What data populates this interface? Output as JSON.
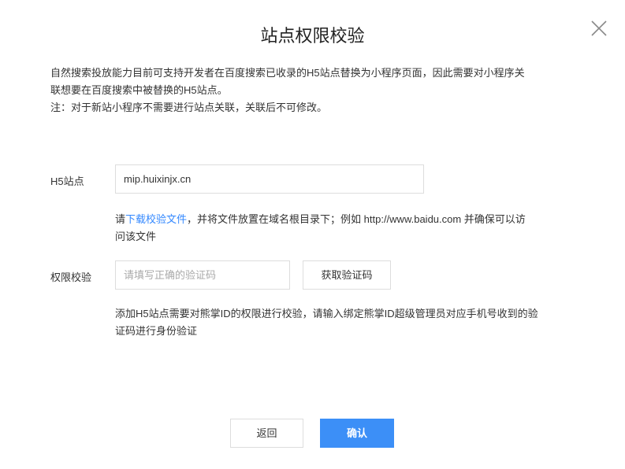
{
  "dialog": {
    "title": "站点权限校验",
    "close_icon": "close-icon"
  },
  "intro": {
    "lines": [
      "自然搜索投放能力目前可支持开发者在百度搜索已收录的H5站点替换为小程序页面，因此需要对小程序关",
      "联想要在百度搜索中被替换的H5站点。",
      "注：对于新站小程序不需要进行站点关联，关联后不可修改。"
    ]
  },
  "site": {
    "label": "H5站点",
    "value": "mip.huixinjx.cn",
    "help_prefix": "请",
    "help_link": "下载校验文件",
    "help_rest": "，并将文件放置在域名根目录下；例如 http://www.baidu.com 并确保可以访",
    "help_line2": "问该文件"
  },
  "verify": {
    "label": "权限校验",
    "placeholder": "请填写正确的验证码",
    "get_code": "获取验证码",
    "help_lines": [
      "添加H5站点需要对熊掌ID的权限进行校验，请输入绑定熊掌ID超级管理员对应手机号收到的验",
      "证码进行身份验证"
    ]
  },
  "footer": {
    "back": "返回",
    "confirm": "确认"
  },
  "colors": {
    "primary": "#3c8ff7",
    "link": "#3388ff"
  }
}
